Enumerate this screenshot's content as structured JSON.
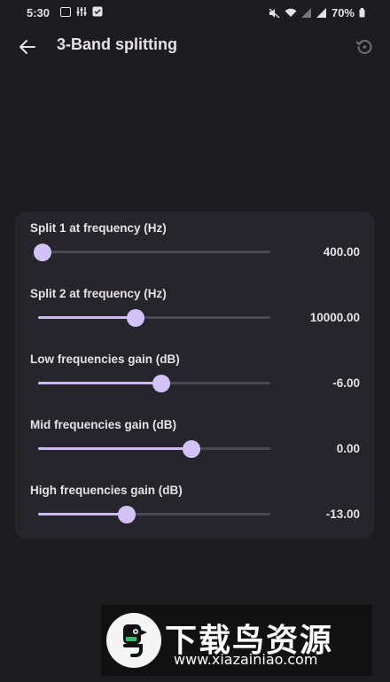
{
  "status_bar": {
    "time": "5:30",
    "battery": "70%"
  },
  "app_bar": {
    "title": "3-Band splitting",
    "back_icon": "arrow-left-icon",
    "reset_icon": "restore-icon"
  },
  "settings": [
    {
      "label": "Split 1 at frequency (Hz)",
      "value": "400.00",
      "slider_fraction": 0.02
    },
    {
      "label": "Split 2 at frequency (Hz)",
      "value": "10000.00",
      "slider_fraction": 0.42
    },
    {
      "label": "Low frequencies gain (dB)",
      "value": "-6.00",
      "slider_fraction": 0.53
    },
    {
      "label": "Mid frequencies gain (dB)",
      "value": "0.00",
      "slider_fraction": 0.66
    },
    {
      "label": "High frequencies gain (dB)",
      "value": "-13.00",
      "slider_fraction": 0.38
    }
  ],
  "colors": {
    "accent": "#cdb9f6",
    "background": "#1c1b1f",
    "card": "#26252b"
  },
  "watermark": {
    "title": "下载鸟资源",
    "url": "www.xiazainiao.com"
  }
}
